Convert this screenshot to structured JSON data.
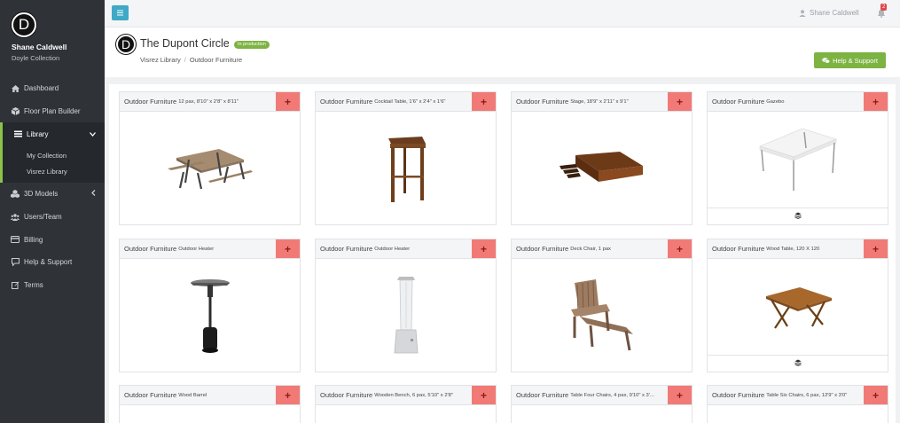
{
  "sidebar": {
    "logo_letter": "D",
    "user_name": "Shane Caldwell",
    "collection": "Doyle Collection",
    "items": [
      {
        "label": "Dashboard",
        "icon": "home-icon"
      },
      {
        "label": "Floor Plan Builder",
        "icon": "cube-icon"
      },
      {
        "label": "Library",
        "icon": "list-icon",
        "caret": "chevron-down"
      },
      {
        "label": "3D Models",
        "icon": "cubes-icon",
        "caret": "chevron-left"
      },
      {
        "label": "Users/Team",
        "icon": "users-icon"
      },
      {
        "label": "Billing",
        "icon": "card-icon"
      },
      {
        "label": "Help & Support",
        "icon": "comment-icon"
      },
      {
        "label": "Terms",
        "icon": "edit-icon"
      }
    ],
    "library_sub": [
      "My Collection",
      "Visrez Library"
    ]
  },
  "topbar": {
    "user_name": "Shane Caldwell",
    "notification_count": "2"
  },
  "header": {
    "logo_letter": "D",
    "title": "The Dupont Circle",
    "status": "In production",
    "breadcrumb": [
      "Visrez Library",
      "Outdoor Furniture"
    ],
    "help_button": "Help & Support"
  },
  "colors": {
    "sidebar_bg": "#2f3338",
    "accent_green": "#7cb342",
    "add_button": "#f17a76",
    "menu_button": "#3fa9c6"
  },
  "cards": [
    {
      "category": "Outdoor Furniture",
      "name": "12 pax, 8'10\" x 2'8\" x 8'11\"",
      "image": "picnic-table",
      "add": "+"
    },
    {
      "category": "Outdoor Furniture",
      "name": "Cocktail Table, 1'6\" x 2'4\" x 1'6\"",
      "image": "cocktail-table",
      "add": "+"
    },
    {
      "category": "Outdoor Furniture",
      "name": "Stage, 18'9\" x 2'11\" x 9'1\"",
      "image": "stage",
      "add": "+"
    },
    {
      "category": "Outdoor Furniture",
      "name": "Gazebo",
      "image": "gazebo",
      "add": "+",
      "footer_icon": "layers-icon"
    },
    {
      "category": "Outdoor Furniture",
      "name": "Outdoor Heater",
      "image": "heater-dark",
      "add": "+"
    },
    {
      "category": "Outdoor Furniture",
      "name": "Outdoor Heater",
      "image": "heater-glass",
      "add": "+"
    },
    {
      "category": "Outdoor Furniture",
      "name": "Deck Chair, 1 pax",
      "image": "deck-chair",
      "add": "+"
    },
    {
      "category": "Outdoor Furniture",
      "name": "Wood Table, 120 X 120",
      "image": "wood-table",
      "add": "+",
      "footer_icon": "layers-icon"
    },
    {
      "category": "Outdoor Furniture",
      "name": "Wood Barrel",
      "image": "",
      "add": "+"
    },
    {
      "category": "Outdoor Furniture",
      "name": "Wooden Bench, 6 pax, 5'10\" x 2'8\"",
      "image": "",
      "add": "+"
    },
    {
      "category": "Outdoor Furniture",
      "name": "Table Four Chairs, 4 pax, 9'10\" x 3'...",
      "image": "",
      "add": "+"
    },
    {
      "category": "Outdoor Furniture",
      "name": "Table Six Chairs, 6 pax, 13'9\" x 3'0\"",
      "image": "",
      "add": "+"
    }
  ]
}
